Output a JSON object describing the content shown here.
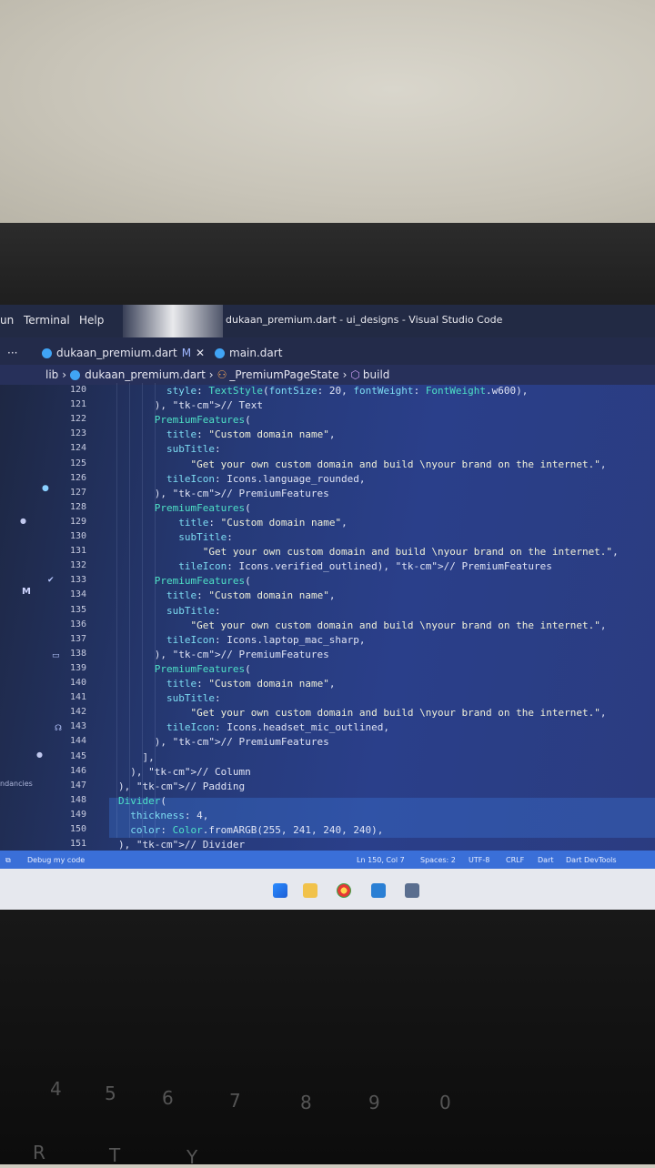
{
  "window": {
    "title": "dukaan_premium.dart - ui_designs - Visual Studio Code",
    "menus": [
      "un",
      "Terminal",
      "Help"
    ]
  },
  "tabs": [
    {
      "label": "dukaan_premium.dart",
      "modified": "M",
      "active": true
    },
    {
      "label": "main.dart",
      "active": false
    }
  ],
  "tabs_more": "···",
  "breadcrumb": [
    "lib",
    "dukaan_premium.dart",
    "_PremiumPageState",
    "build"
  ],
  "sidebar": {
    "badge": "M",
    "section_label": "ndancies"
  },
  "code_lines": [
    {
      "n": "120",
      "text": "        style: TextStyle(fontSize: 20, fontWeight: FontWeight.w600),"
    },
    {
      "n": "121",
      "text": "      ), // Text"
    },
    {
      "n": "122",
      "text": "      PremiumFeatures("
    },
    {
      "n": "123",
      "text": "        title: \"Custom domain name\","
    },
    {
      "n": "124",
      "text": "        subTitle:"
    },
    {
      "n": "125",
      "text": "            \"Get your own custom domain and build \\nyour brand on the internet.\","
    },
    {
      "n": "126",
      "text": "        tileIcon: Icons.language_rounded,"
    },
    {
      "n": "127",
      "text": "      ), // PremiumFeatures"
    },
    {
      "n": "128",
      "text": "      PremiumFeatures("
    },
    {
      "n": "129",
      "text": "          title: \"Custom domain name\","
    },
    {
      "n": "130",
      "text": "          subTitle:"
    },
    {
      "n": "131",
      "text": "              \"Get your own custom domain and build \\nyour brand on the internet.\","
    },
    {
      "n": "132",
      "text": "          tileIcon: Icons.verified_outlined), // PremiumFeatures"
    },
    {
      "n": "133",
      "text": "      PremiumFeatures("
    },
    {
      "n": "134",
      "text": "        title: \"Custom domain name\","
    },
    {
      "n": "135",
      "text": "        subTitle:"
    },
    {
      "n": "136",
      "text": "            \"Get your own custom domain and build \\nyour brand on the internet.\","
    },
    {
      "n": "137",
      "text": "        tileIcon: Icons.laptop_mac_sharp,"
    },
    {
      "n": "138",
      "text": "      ), // PremiumFeatures"
    },
    {
      "n": "139",
      "text": "      PremiumFeatures("
    },
    {
      "n": "140",
      "text": "        title: \"Custom domain name\","
    },
    {
      "n": "141",
      "text": "        subTitle:"
    },
    {
      "n": "142",
      "text": "            \"Get your own custom domain and build \\nyour brand on the internet.\","
    },
    {
      "n": "143",
      "text": "        tileIcon: Icons.headset_mic_outlined,"
    },
    {
      "n": "144",
      "text": "      ), // PremiumFeatures"
    },
    {
      "n": "145",
      "text": "    ],"
    },
    {
      "n": "146",
      "text": "  ), // Column"
    },
    {
      "n": "147",
      "text": "), // Padding"
    },
    {
      "n": "148",
      "text": "Divider("
    },
    {
      "n": "149",
      "text": "  thickness: 4,"
    },
    {
      "n": "150",
      "text": "  color: Color.fromARGB(255, 241, 240, 240),"
    },
    {
      "n": "151",
      "text": "), // Divider"
    }
  ],
  "status": {
    "debug": "Debug my code",
    "position": "Ln 150, Col 7",
    "spaces": "Spaces: 2",
    "encoding": "UTF-8",
    "eol": "CRLF",
    "language": "Dart",
    "devtools": "Dart DevTools"
  },
  "keyboard_keys": [
    "4",
    "5",
    "6",
    "7",
    "8",
    "9",
    "0",
    "R",
    "T",
    "Y"
  ]
}
